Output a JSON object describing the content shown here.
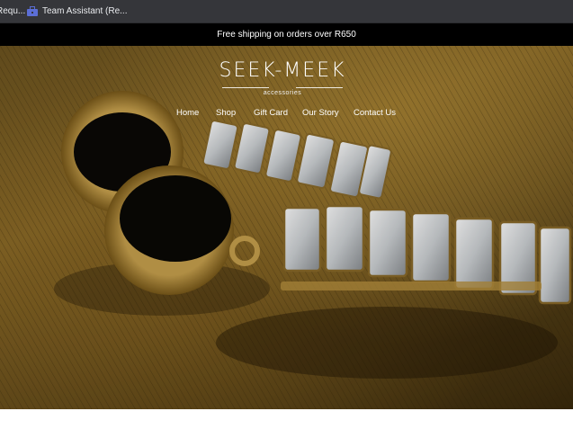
{
  "bookmarks_bar": {
    "items": [
      {
        "label": "Requ...",
        "icon": "generic-bookmark-icon"
      },
      {
        "label": "Team Assistant (Re...",
        "icon": "briefcase-icon"
      }
    ]
  },
  "announcement": {
    "text": "Free shipping on orders over R650"
  },
  "brand": {
    "name": "SEEK-MEEK",
    "tagline": "accessories"
  },
  "nav": {
    "items": [
      {
        "label": "Home"
      },
      {
        "label": "Shop"
      },
      {
        "label": "Gift Card"
      },
      {
        "label": "Our Story"
      },
      {
        "label": "Contact Us"
      }
    ]
  },
  "colors": {
    "announcement_bg": "#000000",
    "bookmarks_bg": "#35363a",
    "hero_gold": "#8a6a28",
    "onyx": "#0b0906"
  }
}
